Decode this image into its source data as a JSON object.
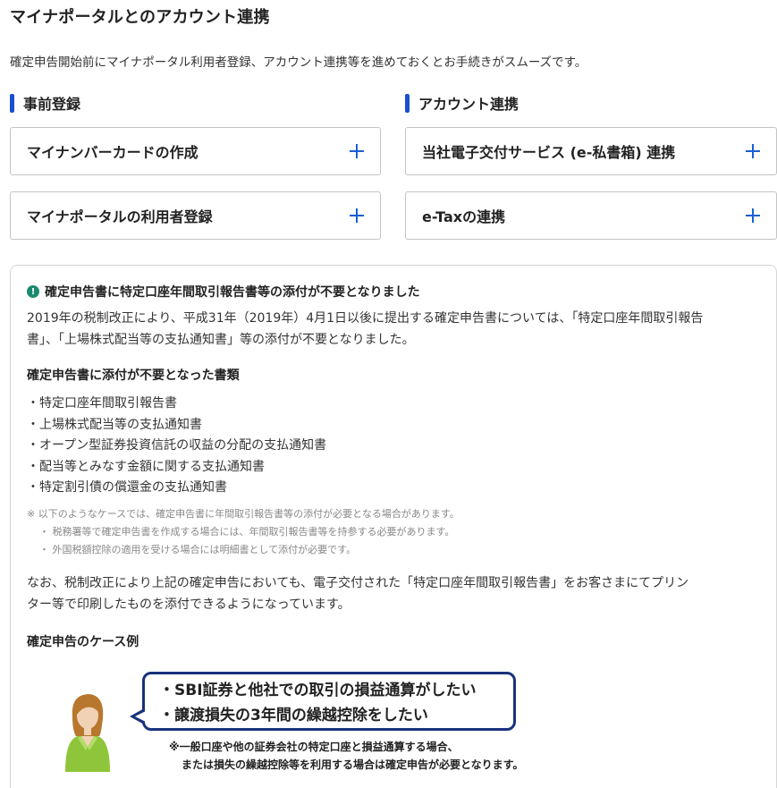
{
  "page": {
    "title": "マイナポータルとのアカウント連携",
    "lead": "確定申告開始前にマイナポータル利用者登録、アカウント連携等を進めておくとお手続きがスムーズです。"
  },
  "sections": {
    "left": {
      "title": "事前登録",
      "items": [
        {
          "label": "マイナンバーカードの作成"
        },
        {
          "label": "マイナポータルの利用者登録"
        }
      ]
    },
    "right": {
      "title": "アカウント連携",
      "items": [
        {
          "label": "当社電子交付サービス (e-私書箱) 連携"
        },
        {
          "label": "e-Taxの連携"
        }
      ]
    }
  },
  "icons": {
    "accordion": "plus-icon",
    "notice": "exclamation-icon"
  },
  "colors": {
    "accent": "#1a5fd6",
    "section_bar": "#1a4fd0",
    "notice_icon": "#1b8a6e",
    "bubble_border": "#18327c"
  },
  "notice": {
    "icon_glyph": "!",
    "title": "確定申告書に特定口座年間取引報告書等の添付が不要となりました",
    "body_line1": "2019年の税制改正により、平成31年（2019年）4月1日以後に提出する確定申告書については、「特定口座年間取引報告",
    "body_line2": "書」、「上場株式配当等の支払通知書」等の添付が不要となりました。",
    "docs_title": "確定申告書に添付が不要となった書類",
    "docs": [
      "特定口座年間取引報告書",
      "上場株式配当等の支払通知書",
      "オープン型証券投資信託の収益の分配の支払通知書",
      "配当等とみなす金額に関する支払通知書",
      "特定割引債の償還金の支払通知書"
    ],
    "note_main": "※ 以下のようなケースでは、確定申告書に年間取引報告書等の添付が必要となる場合があります。",
    "note_sub1": "・ 税務署等で確定申告書を作成する場合には、年間取引報告書等を持参する必要があります。",
    "note_sub2": "・ 外国税額控除の適用を受ける場合には明細書として添付が必要です。",
    "para2_line1": "なお、税制改正により上記の確定申告においても、電子交付された「特定口座年間取引報告書」をお客さまにてプリン",
    "para2_line2": "ター等で印刷したものを添付できるようになっています。",
    "case_title": "確定申告のケース例",
    "case": {
      "bubble_line1": "・SBI証券と他社での取引の損益通算がしたい",
      "bubble_line2": "・譲渡損失の3年間の繰越控除をしたい",
      "note_line1": "※一般口座や他の証券会社の特定口座と損益通算する場合、",
      "note_line2": "または損失の繰越控除等を利用する場合は確定申告が必要となります。"
    }
  }
}
